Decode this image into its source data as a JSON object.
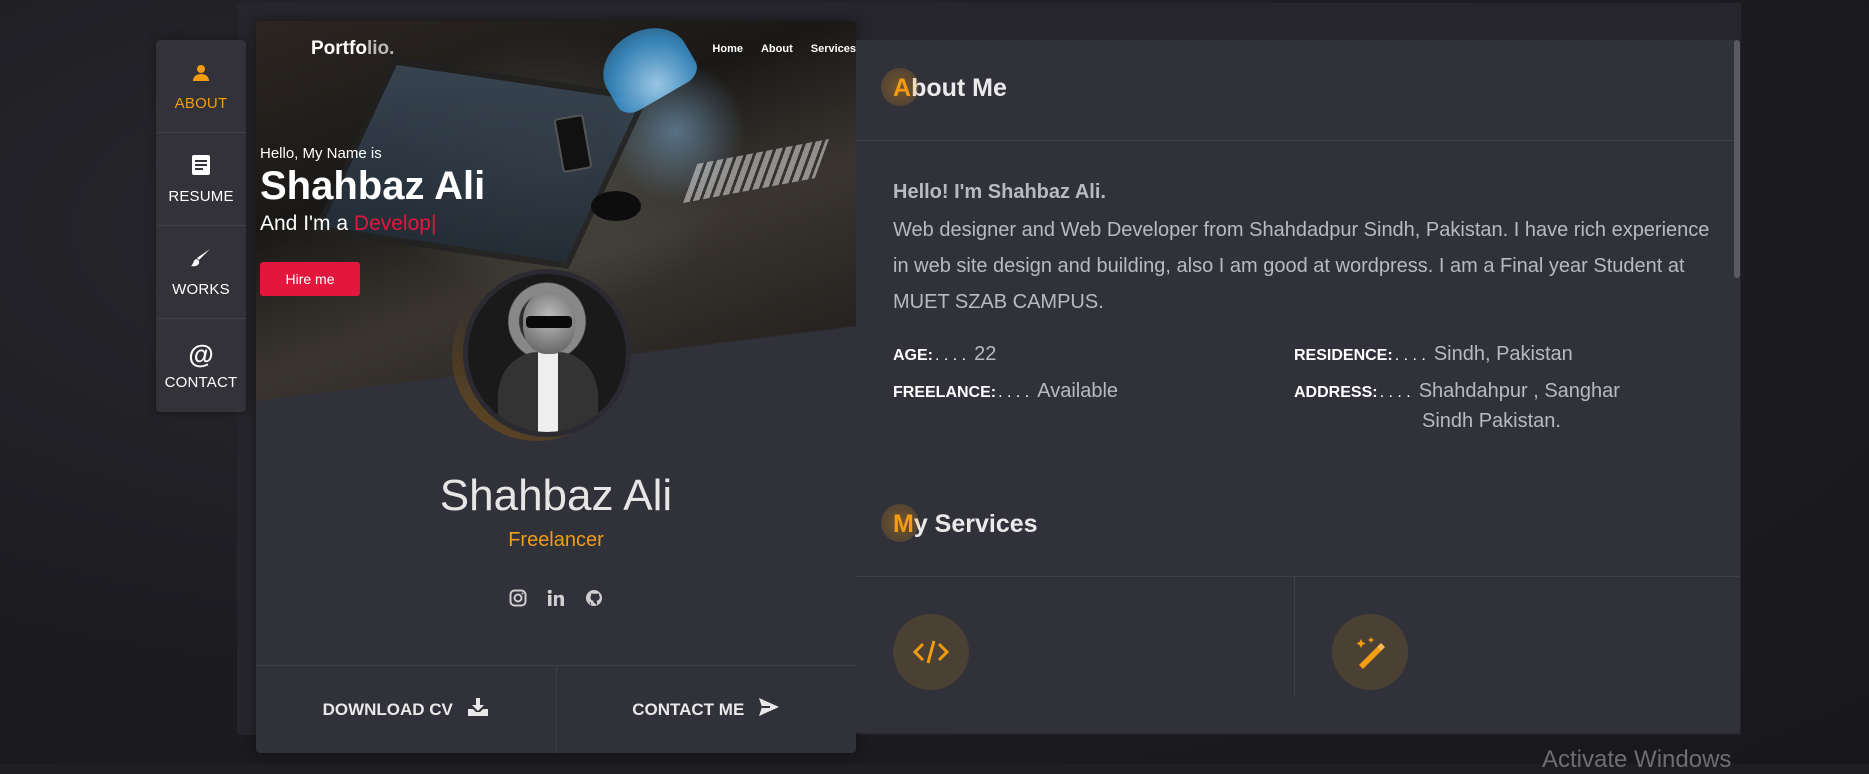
{
  "nav": {
    "items": [
      {
        "label": "ABOUT",
        "icon": "user-icon",
        "glyph": "👤"
      },
      {
        "label": "RESUME",
        "icon": "document-icon",
        "glyph": "▤"
      },
      {
        "label": "WORKS",
        "icon": "brush-icon",
        "glyph": "🖌"
      },
      {
        "label": "CONTACT",
        "icon": "at-icon",
        "glyph": "@"
      }
    ]
  },
  "card": {
    "brand_main": "Portfo",
    "brand_dim": "lio.",
    "links": [
      "Home",
      "About",
      "Services"
    ],
    "hello": "Hello, My Name is",
    "name": "Shahbaz Ali",
    "role_prefix": "And I'm a",
    "role_highlight": "Develop|",
    "hire_label": "Hire me",
    "profile_name": "Shahbaz Ali",
    "profile_title": "Freelancer",
    "download_label": "DOWNLOAD CV",
    "contact_label": "CONTACT ME"
  },
  "about": {
    "title_first": "A",
    "title_rest": "bout Me",
    "lead": "Hello! I'm Shahbaz Ali.",
    "text": "Web designer and Web Developer  from Shahdadpur Sindh, Pakistan. I have rich experience in web site design and building, also I am good at wordpress. I am a Final year Student at MUET SZAB CAMPUS.",
    "age_key": "AGE:",
    "age": "22",
    "freelance_key": "FREELANCE:",
    "freelance": "Available",
    "residence_key": "RESIDENCE:",
    "residence": "Sindh, Pakistan",
    "address_key": "ADDRESS:",
    "address_1": "Shahdahpur , Sanghar",
    "address_2": "Sindh Pakistan.",
    "dots": ". . . ."
  },
  "services": {
    "title_first": "M",
    "title_rest": "y Services"
  },
  "watermark": "Activate Windows",
  "colors": {
    "accent": "#f39c12",
    "highlight": "#e3173e",
    "panel": "#31313a"
  }
}
